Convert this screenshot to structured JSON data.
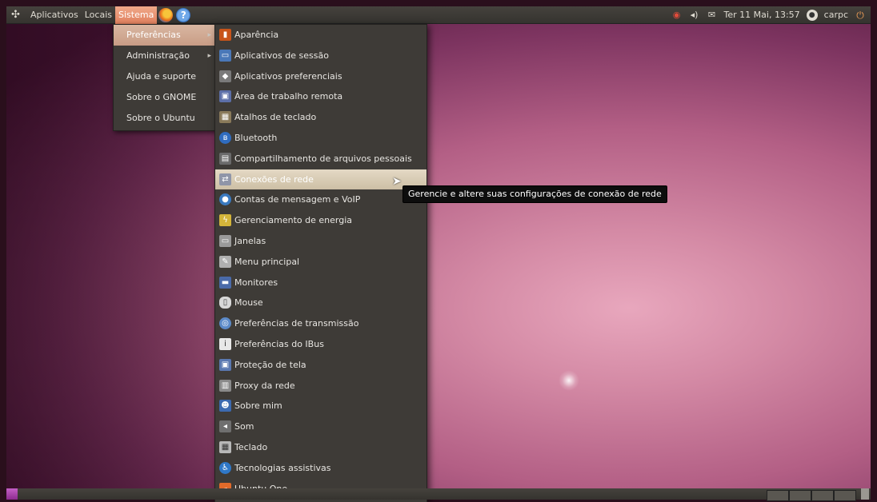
{
  "top_panel": {
    "menus": [
      "Aplicativos",
      "Locais",
      "Sistema"
    ],
    "active_menu": "Sistema",
    "launchers": [
      "firefox-icon",
      "help-icon"
    ],
    "tray": {
      "clock": "Ter 11 Mai, 13:57",
      "user": "carpc",
      "icons": [
        "network-icon",
        "volume-icon",
        "mail-icon",
        "user-icon",
        "power-icon"
      ]
    }
  },
  "sistema_menu": {
    "items": [
      {
        "label": "Preferências",
        "submenu": true,
        "highlighted": true
      },
      {
        "label": "Administração",
        "submenu": true
      },
      {
        "label": "Ajuda e suporte"
      },
      {
        "label": "Sobre o GNOME"
      },
      {
        "label": "Sobre o Ubuntu"
      }
    ]
  },
  "preferences_menu": {
    "items": [
      {
        "label": "Aparência",
        "icon": "appearance-icon"
      },
      {
        "label": "Aplicativos de sessão",
        "icon": "session-icon"
      },
      {
        "label": "Aplicativos preferenciais",
        "icon": "preferred-apps-icon"
      },
      {
        "label": "Área de trabalho remota",
        "icon": "remote-desktop-icon"
      },
      {
        "label": "Atalhos de teclado",
        "icon": "keyboard-shortcuts-icon"
      },
      {
        "label": "Bluetooth",
        "icon": "bluetooth-icon"
      },
      {
        "label": "Compartilhamento de arquivos pessoais",
        "icon": "file-sharing-icon"
      },
      {
        "label": "Conexões de rede",
        "icon": "network-connections-icon",
        "highlighted": true
      },
      {
        "label": "Contas de mensagem e VoIP",
        "icon": "messaging-icon"
      },
      {
        "label": "Gerenciamento de energia",
        "icon": "power-management-icon"
      },
      {
        "label": "Janelas",
        "icon": "windows-icon"
      },
      {
        "label": "Menu principal",
        "icon": "main-menu-icon"
      },
      {
        "label": "Monitores",
        "icon": "monitors-icon"
      },
      {
        "label": "Mouse",
        "icon": "mouse-icon"
      },
      {
        "label": "Preferências de transmissão",
        "icon": "transmission-icon"
      },
      {
        "label": "Preferências do IBus",
        "icon": "ibus-icon"
      },
      {
        "label": "Proteção de tela",
        "icon": "screensaver-icon"
      },
      {
        "label": "Proxy da rede",
        "icon": "proxy-icon"
      },
      {
        "label": "Sobre mim",
        "icon": "about-me-icon"
      },
      {
        "label": "Som",
        "icon": "sound-icon"
      },
      {
        "label": "Teclado",
        "icon": "keyboard-icon"
      },
      {
        "label": "Tecnologias assistivas",
        "icon": "accessibility-icon"
      },
      {
        "label": "Ubuntu One",
        "icon": "ubuntu-one-icon"
      }
    ]
  },
  "tooltip": {
    "text": "Gerencie e altere suas configurações de conexão de rede"
  }
}
